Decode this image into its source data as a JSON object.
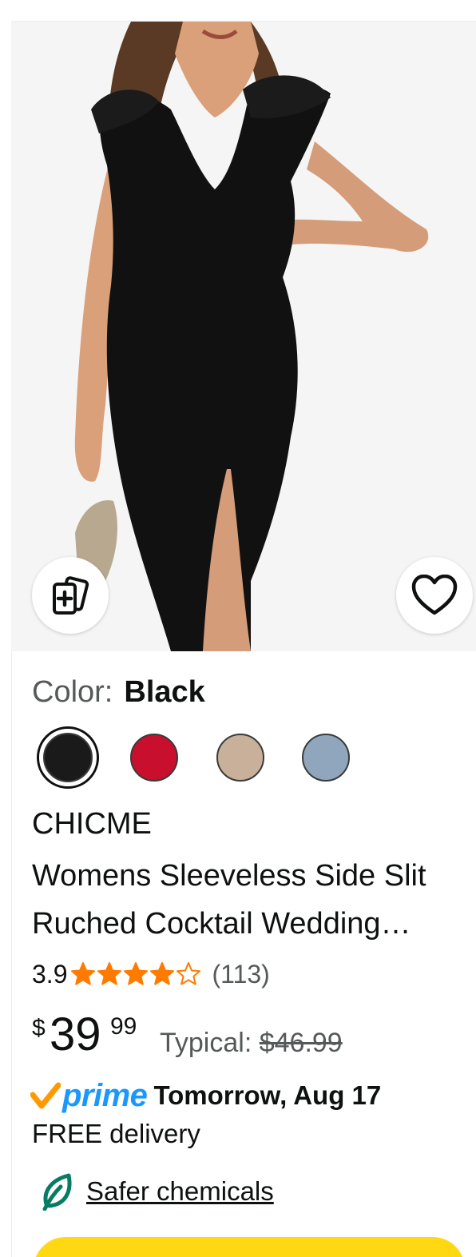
{
  "product": {
    "image_alt": "product-image",
    "color_label": "Color:",
    "color_value": "Black",
    "swatches": [
      {
        "name": "black",
        "color": "#1a1a1a",
        "selected": true
      },
      {
        "name": "red",
        "color": "#c8102e",
        "selected": false
      },
      {
        "name": "tan",
        "color": "#c9b09b",
        "selected": false
      },
      {
        "name": "blue-gray",
        "color": "#8fa6bd",
        "selected": false
      }
    ],
    "brand": "CHICME",
    "title_line1": "Womens Sleeveless Side Slit",
    "title_line2": "Ruched Cocktail Wedding…",
    "rating": "3.9",
    "rating_value": 3.9,
    "rating_max": 5,
    "review_count": "(113)",
    "price_symbol": "$",
    "price_whole": "39",
    "price_fraction": "99",
    "typical_label": "Typical:",
    "typical_price": "$46.99",
    "prime_word": "prime",
    "delivery_date": "Tomorrow, Aug 17",
    "free_delivery": "FREE delivery",
    "chemicals_link": "Safer chemicals"
  },
  "icons": {
    "compare": "compare-cards-icon",
    "wishlist": "heart-icon",
    "star": "star-icon",
    "prime_check": "prime-check-icon",
    "leaf": "leaf-icon"
  },
  "colors": {
    "star": "#ff7b00",
    "prime_blue": "#1a98ff",
    "prime_check": "#ff9900",
    "leaf": "#067d62",
    "add_to_cart": "#ffd814"
  }
}
